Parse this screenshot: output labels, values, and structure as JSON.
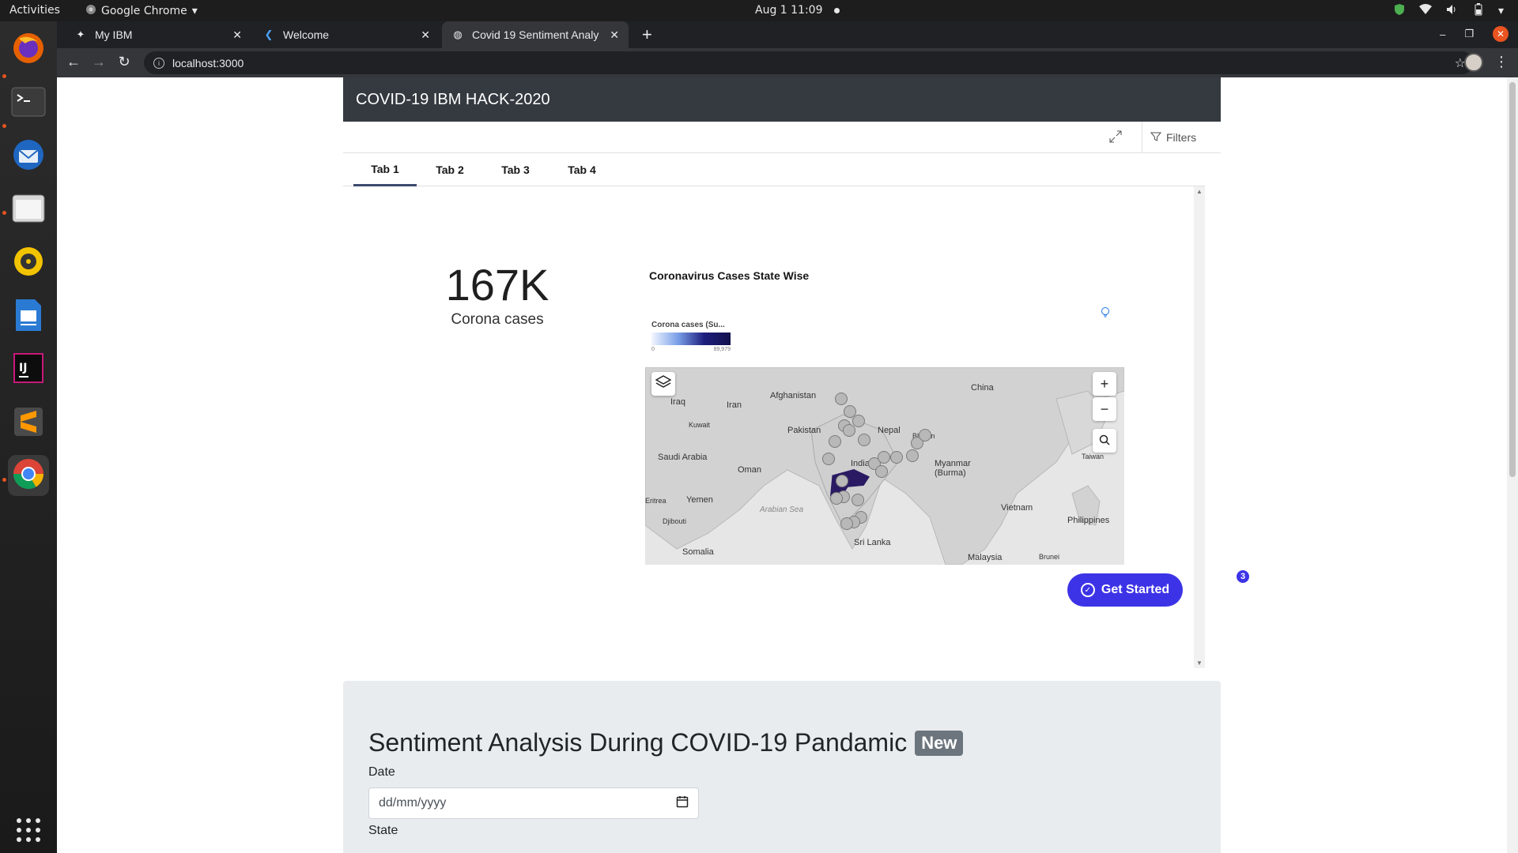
{
  "os": {
    "activities": "Activities",
    "app_name": "Google Chrome",
    "clock": "Aug 1  11:09"
  },
  "browser": {
    "tabs": [
      {
        "title": "My IBM",
        "active": false
      },
      {
        "title": "Welcome",
        "active": false
      },
      {
        "title": "Covid 19 Sentiment Analy",
        "active": true
      }
    ],
    "url": "localhost:3000"
  },
  "dashboard": {
    "header_title": "COVID-19 IBM HACK-2020",
    "filters_label": "Filters",
    "tabs": [
      "Tab 1",
      "Tab 2",
      "Tab 3",
      "Tab 4"
    ],
    "kpi": {
      "value": "167K",
      "label": "Corona cases"
    },
    "map": {
      "title": "Coronavirus Cases State Wise",
      "legend_title": "Corona cases (Su...",
      "legend_min": "0",
      "legend_max": "89,979",
      "labels": {
        "afghanistan": "Afghanistan",
        "china": "China",
        "iraq": "Iraq",
        "iran": "Iran",
        "kuwait": "Kuwait",
        "pakistan": "Pakistan",
        "nepal": "Nepal",
        "bhutan": "Bhutan",
        "saudi_arabia": "Saudi Arabia",
        "oman": "Oman",
        "india": "India",
        "myanmar": "Myanmar\n(Burma)",
        "taiwan": "Taiwan",
        "eritrea": "Eritrea",
        "yemen": "Yemen",
        "arabian_sea": "Arabian Sea",
        "vietnam": "Vietnam",
        "djibouti": "Djibouti",
        "philippines": "Philippines",
        "sri_lanka": "Sri Lanka",
        "somalia": "Somalia",
        "malaysia": "Malaysia",
        "brunei": "Brunei"
      }
    },
    "get_started": {
      "label": "Get Started",
      "badge": "3"
    }
  },
  "sentiment": {
    "title": "Sentiment Analysis During COVID-19 Pandamic",
    "badge": "New",
    "date_label": "Date",
    "date_placeholder": "dd/mm/yyyy",
    "state_label": "State"
  }
}
